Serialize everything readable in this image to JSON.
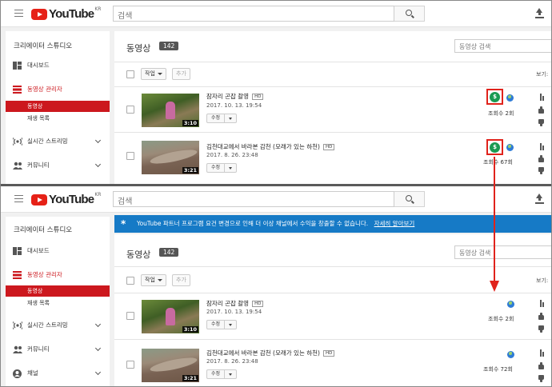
{
  "topbar": {
    "logo_text": "YouTube",
    "logo_region": "KR",
    "search_placeholder": "검색"
  },
  "sidebar": {
    "studio_title": "크리에이터 스튜디오",
    "dashboard": "대시보드",
    "video_manager": "동영상 관리자",
    "videos": "동영상",
    "playlists": "재생 목록",
    "live": "실시간 스트리밍",
    "community": "커뮤니티",
    "channel": "채널"
  },
  "main": {
    "heading": "동영상",
    "count": "142",
    "search_placeholder": "동영상 검색",
    "action_label": "작업",
    "add_label": "추가",
    "view_label": "보기:",
    "edit_label": "수정",
    "banner_text": "YouTube 파트너 프로그램 요건 변경으로 인해 더 이상 채널에서 수익을 창출할 수 없습니다.",
    "banner_link": "자세히 알아보기"
  },
  "videos_before": [
    {
      "title": "잠자리 곤잡 촬영",
      "badge": "HD",
      "date": "2017. 10. 13. 19:54",
      "duration": "3:10",
      "views": "조회수 2회",
      "monetized": true
    },
    {
      "title": "김천대교에서 바라본 감천 (모래가 있는 하천)",
      "badge": "HD",
      "date": "2017. 8. 26. 23:48",
      "duration": "3:21",
      "views": "조회수 67회",
      "monetized": true
    }
  ],
  "videos_after": [
    {
      "title": "잠자리 곤잡 촬영",
      "badge": "HD",
      "date": "2017. 10. 13. 19:54",
      "duration": "3:10",
      "views": "조회수 2회",
      "monetized": false
    },
    {
      "title": "김천대교에서 바라본 감천 (모래가 있는 하천)",
      "badge": "HD",
      "date": "2017. 8. 26. 23:48",
      "duration": "3:21",
      "views": "조회수 72회",
      "monetized": false
    }
  ],
  "colors": {
    "brand_red": "#cc181e",
    "monetize_green": "#1a9a52",
    "banner_blue": "#167ac6",
    "annotation_red": "#e0231c"
  },
  "icons": {
    "upload": "upload-icon",
    "search": "search-icon",
    "dollar": "monetization-icon",
    "globe": "public-icon"
  }
}
